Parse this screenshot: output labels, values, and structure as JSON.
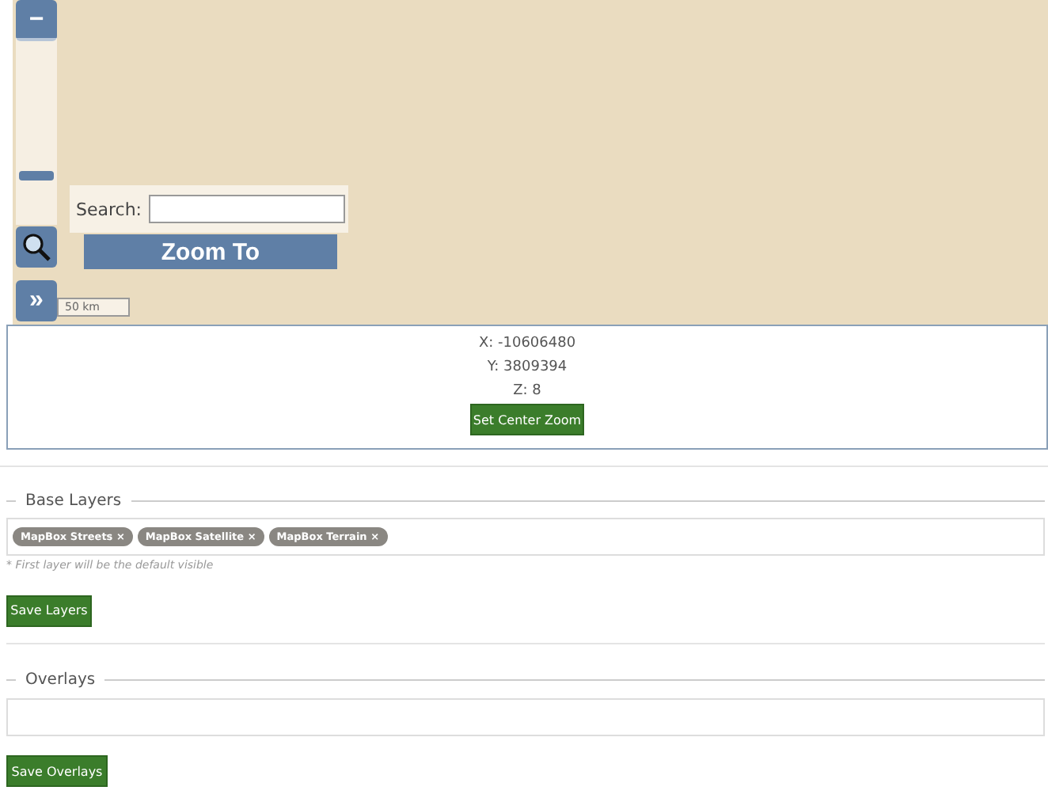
{
  "map": {
    "zoom_out": "−",
    "zoom_slider": {
      "level": 0.25
    },
    "search": {
      "label": "Search:"
    },
    "zoom_to": "Zoom To",
    "expand": "»",
    "scale": "50 km"
  },
  "center": {
    "x": "X: -10606480",
    "y": "Y: 3809394",
    "z": "Z: 8",
    "button": "Set Center Zoom"
  },
  "base_layers": {
    "legend": "Base Layers",
    "tags": [
      {
        "label": "MapBox Streets",
        "remove": "×"
      },
      {
        "label": "MapBox Satellite",
        "remove": "×"
      },
      {
        "label": "MapBox Terrain",
        "remove": "×"
      }
    ],
    "hint": "* First layer will be the default visible",
    "button": "Save Layers"
  },
  "overlays": {
    "legend": "Overlays",
    "button": "Save Overlays"
  }
}
